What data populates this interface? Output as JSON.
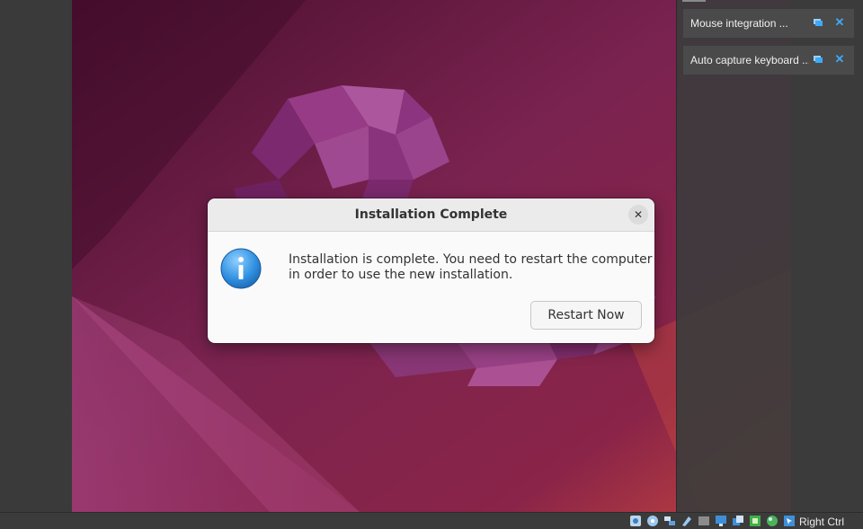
{
  "notifications": [
    {
      "label": "Mouse integration ...",
      "pin_icon": "pin-icon",
      "close_icon": "close-icon"
    },
    {
      "label": "Auto capture keyboard ...",
      "pin_icon": "pin-icon",
      "close_icon": "close-icon"
    }
  ],
  "dialog": {
    "title": "Installation Complete",
    "close_glyph": "✕",
    "icon": "info-icon",
    "message_line1": "Installation is complete. You need to restart the computer",
    "message_line2": "in order to use the new installation.",
    "restart_label": "Restart Now"
  },
  "statusbar": {
    "icons": [
      "hard-disk-icon",
      "optical-drive-icon",
      "network-icon",
      "usb-icon",
      "shared-folder-icon",
      "display-icon",
      "recording-icon",
      "cpu-icon",
      "network-status-icon",
      "mouse-integration-icon"
    ],
    "host_key": "Right Ctrl"
  },
  "colors": {
    "wallpaper_base": "#6e1f45",
    "accent_blue": "#3fa9f5",
    "dialog_bg": "#fafafa"
  }
}
